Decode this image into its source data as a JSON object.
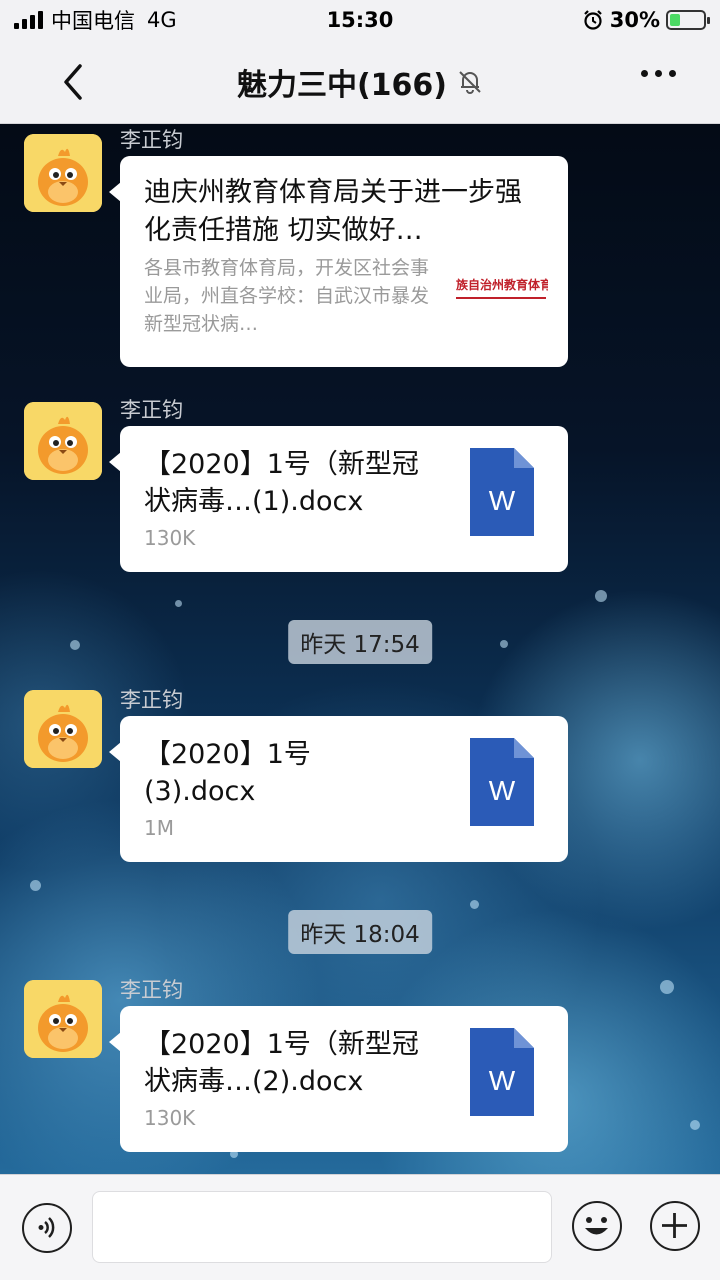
{
  "status": {
    "carrier": "中国电信",
    "network": "4G",
    "time": "15:30",
    "battery_text": "30%",
    "battery_level": 0.3,
    "alarm_icon": "alarm-icon"
  },
  "nav": {
    "title": "魅力三中(166)",
    "back_icon": "chevron-left-icon",
    "mute_icon": "bell-slash-icon",
    "more_icon": "more-icon"
  },
  "messages": [
    {
      "kind": "article",
      "sender": "李正钧",
      "title": "迪庆州教育体育局关于进一步强化责任措施  切实做好…",
      "description": "各县市教育体育局，开发区社会事业局，州直各学校：自武汉市暴发新型冠状病…",
      "thumb_text": "族自治州教育体育"
    },
    {
      "kind": "file",
      "sender": "李正钧",
      "filename": "【2020】1号（新型冠状病毒…(1).docx",
      "size": "130K",
      "icon_letter": "W"
    },
    {
      "kind": "time",
      "text": "昨天 17:54"
    },
    {
      "kind": "file",
      "sender": "李正钧",
      "filename": "【2020】1号\n(3).docx",
      "size": "1M",
      "icon_letter": "W"
    },
    {
      "kind": "time",
      "text": "昨天 18:04"
    },
    {
      "kind": "file",
      "sender": "李正钧",
      "filename": "【2020】1号（新型冠状病毒…(2).docx",
      "size": "130K",
      "icon_letter": "W"
    }
  ],
  "input": {
    "voice_icon": "voice-icon",
    "emoji_icon": "emoji-icon",
    "add_icon": "plus-circle-icon",
    "value": ""
  },
  "colors": {
    "word_blue": "#2b5bb7",
    "bar_bg": "#f2f2f4",
    "bubble_bg": "#ffffff"
  }
}
